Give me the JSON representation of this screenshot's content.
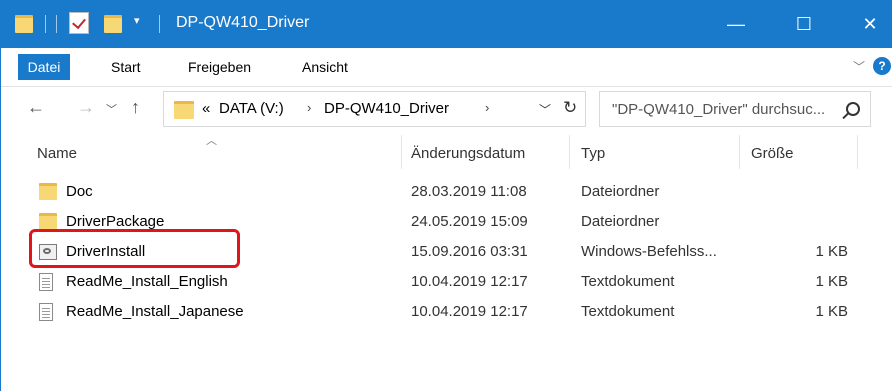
{
  "window": {
    "title": "DP-QW410_Driver"
  },
  "window_controls": {
    "minimize": "—",
    "maximize": "☐",
    "close": "✕"
  },
  "ribbon": {
    "tabs": [
      {
        "label": "Datei"
      },
      {
        "label": "Start"
      },
      {
        "label": "Freigeben"
      },
      {
        "label": "Ansicht"
      }
    ],
    "help": "?"
  },
  "address": {
    "overflow": "«",
    "crumbs": [
      "DATA (V:)",
      "DP-QW410_Driver"
    ],
    "separator": "›"
  },
  "search": {
    "placeholder": "\"DP-QW410_Driver\" durchsuc..."
  },
  "columns": {
    "name": "Name",
    "date": "Änderungsdatum",
    "type": "Typ",
    "size": "Größe"
  },
  "files": [
    {
      "name": "Doc",
      "date": "28.03.2019 11:08",
      "type": "Dateiordner",
      "size": "",
      "icon": "folder-icon"
    },
    {
      "name": "DriverPackage",
      "date": "24.05.2019 15:09",
      "type": "Dateiordner",
      "size": "",
      "icon": "folder-icon"
    },
    {
      "name": "DriverInstall",
      "date": "15.09.2016 03:31",
      "type": "Windows-Befehlss...",
      "size": "1 KB",
      "icon": "batch-file-icon"
    },
    {
      "name": "ReadMe_Install_English",
      "date": "10.04.2019 12:17",
      "type": "Textdokument",
      "size": "1 KB",
      "icon": "text-file-icon"
    },
    {
      "name": "ReadMe_Install_Japanese",
      "date": "10.04.2019 12:17",
      "type": "Textdokument",
      "size": "1 KB",
      "icon": "text-file-icon"
    }
  ],
  "colors": {
    "accent": "#1979ca",
    "highlight": "#e0141b",
    "folder": "#f8d775"
  }
}
